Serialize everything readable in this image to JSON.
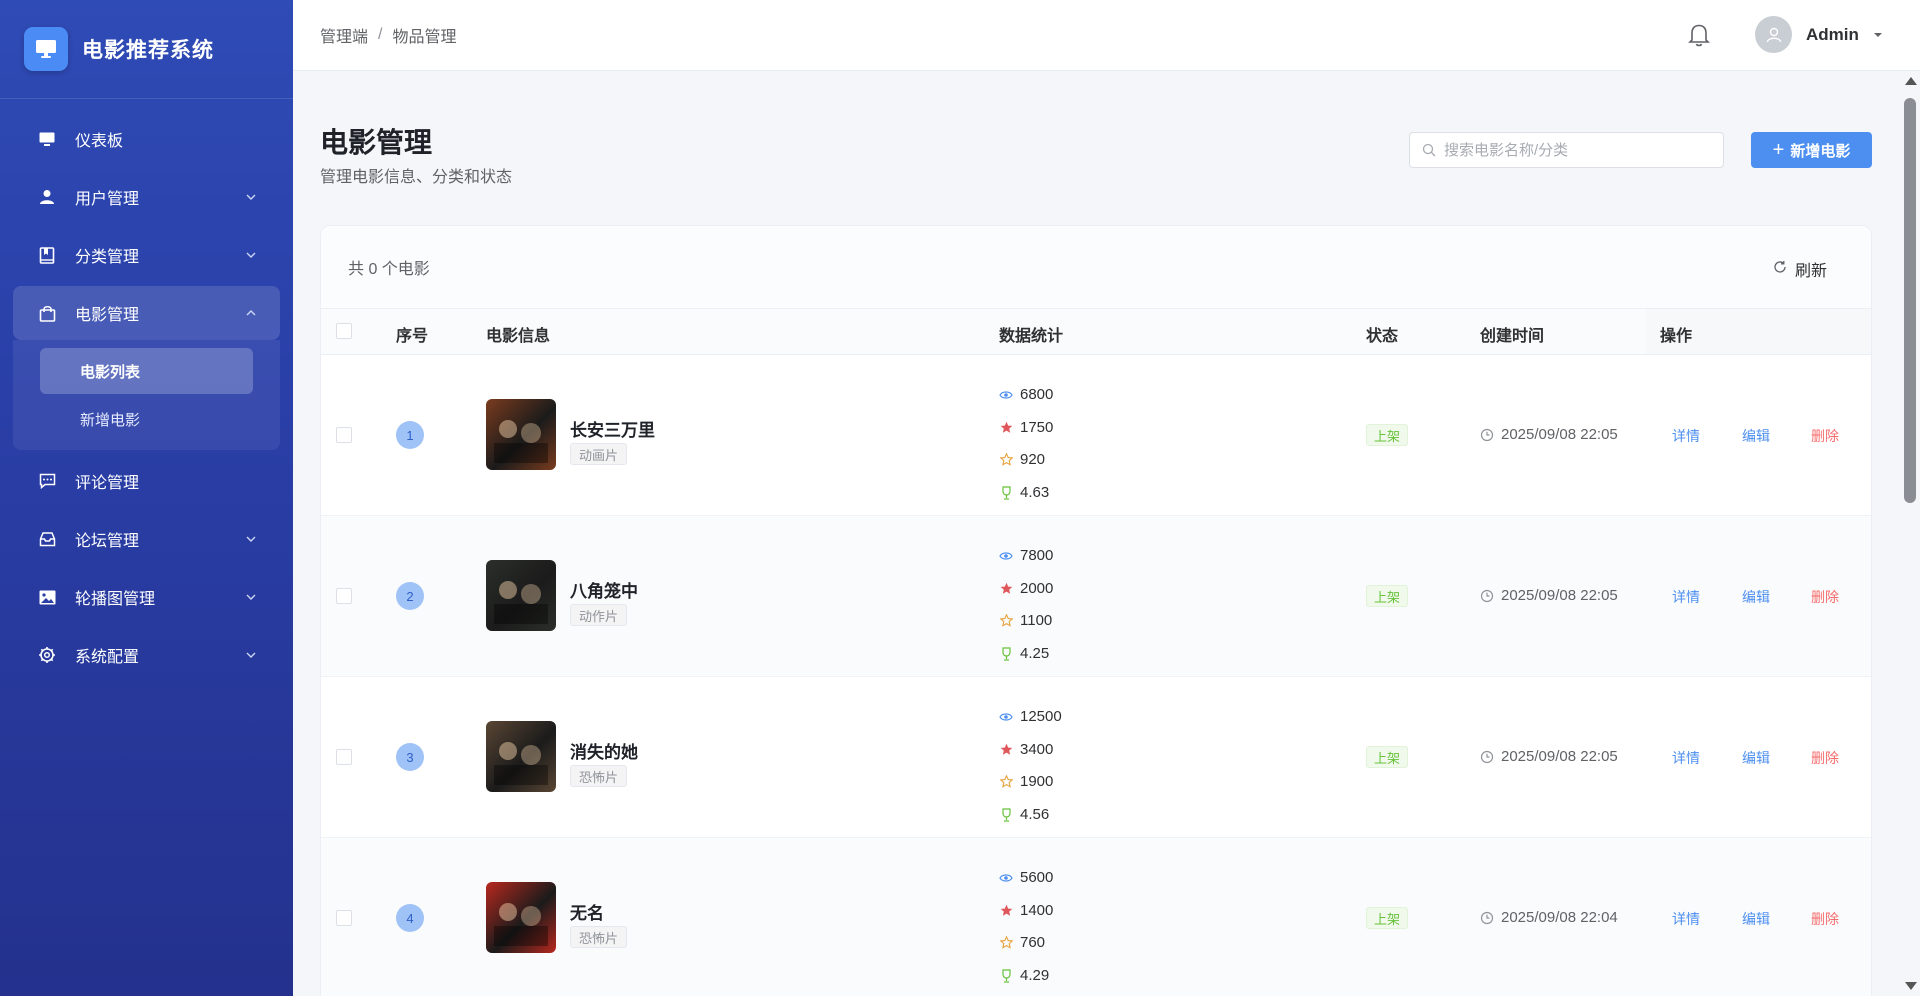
{
  "app": {
    "title": "电影推荐系统"
  },
  "sidebar": {
    "items": [
      {
        "label": "仪表板",
        "icon": "monitor-icon",
        "arrow": "none"
      },
      {
        "label": "用户管理",
        "icon": "user-icon",
        "arrow": "down"
      },
      {
        "label": "分类管理",
        "icon": "book-icon",
        "arrow": "down"
      },
      {
        "label": "电影管理",
        "icon": "bag-icon",
        "arrow": "up"
      },
      {
        "label": "评论管理",
        "icon": "comment-icon",
        "arrow": "none"
      },
      {
        "label": "论坛管理",
        "icon": "inbox-icon",
        "arrow": "down"
      },
      {
        "label": "轮播图管理",
        "icon": "image-icon",
        "arrow": "down"
      },
      {
        "label": "系统配置",
        "icon": "gear-icon",
        "arrow": "down"
      }
    ],
    "submenu": [
      {
        "label": "电影列表"
      },
      {
        "label": "新增电影"
      }
    ]
  },
  "header": {
    "breadcrumb": [
      "管理端",
      "/",
      "物品管理"
    ],
    "user": "Admin"
  },
  "page": {
    "title": "电影管理",
    "subtitle": "管理电影信息、分类和状态",
    "search_placeholder": "搜索电影名称/分类",
    "add_button": "新增电影",
    "total": "共 0 个电影",
    "refresh": "刷新"
  },
  "table": {
    "columns": [
      "序号",
      "电影信息",
      "数据统计",
      "状态",
      "创建时间",
      "操作"
    ],
    "actions": {
      "detail": "详情",
      "edit": "编辑",
      "delete": "删除"
    },
    "rows": [
      {
        "index": "1",
        "title": "长安三万里",
        "tag": "动画片",
        "views": "6800",
        "likes": "1750",
        "favorites": "920",
        "rating": "4.63",
        "status": "上架",
        "created": "2025/09/08 22:05",
        "poster_color": "#7a3b1e"
      },
      {
        "index": "2",
        "title": "八角笼中",
        "tag": "动作片",
        "views": "7800",
        "likes": "2000",
        "favorites": "1100",
        "rating": "4.25",
        "status": "上架",
        "created": "2025/09/08 22:05",
        "poster_color": "#2b2f2a"
      },
      {
        "index": "3",
        "title": "消失的她",
        "tag": "恐怖片",
        "views": "12500",
        "likes": "3400",
        "favorites": "1900",
        "rating": "4.56",
        "status": "上架",
        "created": "2025/09/08 22:05",
        "poster_color": "#5a4634"
      },
      {
        "index": "4",
        "title": "无名",
        "tag": "恐怖片",
        "views": "5600",
        "likes": "1400",
        "favorites": "760",
        "rating": "4.29",
        "status": "上架",
        "created": "2025/09/08 22:04",
        "poster_color": "#b8281e"
      }
    ]
  },
  "colors": {
    "accent": "#4d8ff0",
    "danger": "#f56c6c",
    "success": "#67c23a",
    "sidebar": "#2a3fa8"
  }
}
